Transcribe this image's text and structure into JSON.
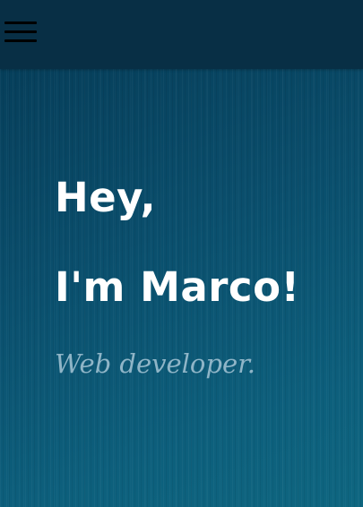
{
  "header": {
    "menu_icon": "hamburger-menu-icon"
  },
  "hero": {
    "greeting_line1": "Hey,",
    "greeting_line2": "I'm Marco!",
    "subtitle": "Web developer."
  },
  "colors": {
    "header_background": "#082f45",
    "hero_background": "#0b4b67",
    "heading_text": "#ffffff",
    "subtitle_text": "#8fb5c7"
  }
}
